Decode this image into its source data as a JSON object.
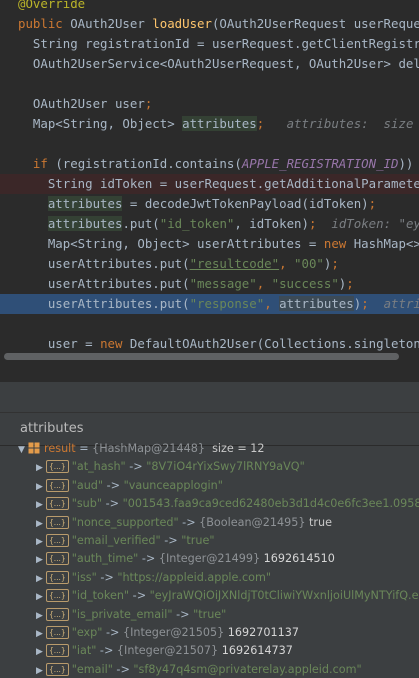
{
  "editor": {
    "lines": [
      [
        {
          "t": "@Override",
          "c": "a"
        }
      ],
      [
        {
          "t": "public ",
          "c": "k"
        },
        {
          "t": "OAuth2User ",
          "c": "p"
        },
        {
          "t": "loadUser",
          "c": "f"
        },
        {
          "t": "(OAuth2UserRequest userRequest",
          "c": "p"
        }
      ],
      [
        {
          "t": "  String registrationId = userRequest.getClientRegistrat",
          "c": "p"
        }
      ],
      [
        {
          "t": "  OAuth2UserService<OAuth2UserRequest, OAuth2User> deleg",
          "c": "p"
        }
      ],
      [],
      [
        {
          "t": "  OAuth2User user",
          "c": "p"
        },
        {
          "t": ";",
          "c": "k"
        }
      ],
      [
        {
          "t": "  Map<String, Object> ",
          "c": "p"
        },
        {
          "t": "attributes",
          "c": "p ac"
        },
        {
          "t": ";",
          "c": "k"
        },
        {
          "t": "   attributes:  size = ",
          "c": "h"
        }
      ],
      [],
      [
        {
          "t": "  ",
          "c": "p"
        },
        {
          "t": "if ",
          "c": "k"
        },
        {
          "t": "(registrationId.contains(",
          "c": "p"
        },
        {
          "t": "APPLE_REGISTRATION_ID",
          "c": "c"
        },
        {
          "t": ")) {",
          "c": "p"
        }
      ],
      [
        {
          "t": "    String idToken = userRequest.getAdditionalParameters",
          "c": "p"
        }
      ],
      [
        {
          "t": "    ",
          "c": "p"
        },
        {
          "t": "attributes",
          "c": "p ac"
        },
        {
          "t": " = decodeJwtTokenPayload(idToken)",
          "c": "p"
        },
        {
          "t": ";",
          "c": "k"
        }
      ],
      [
        {
          "t": "    ",
          "c": "p"
        },
        {
          "t": "attributes",
          "c": "p ac"
        },
        {
          "t": ".put(",
          "c": "p"
        },
        {
          "t": "\"id_token\"",
          "c": "s"
        },
        {
          "t": ", idToken)",
          "c": "p"
        },
        {
          "t": ";",
          "c": "k"
        },
        {
          "t": "  idToken: \"eyJ",
          "c": "h"
        }
      ],
      [
        {
          "t": "    Map<String, Object> userAttributes = ",
          "c": "p"
        },
        {
          "t": "new ",
          "c": "k"
        },
        {
          "t": "HashMap<>()",
          "c": "p"
        }
      ],
      [
        {
          "t": "    userAttributes.put(",
          "c": "p"
        },
        {
          "t": "\"resultcode\"",
          "c": "s su"
        },
        {
          "t": ", ",
          "c": "k"
        },
        {
          "t": "\"00\"",
          "c": "s"
        },
        {
          "t": ")",
          "c": "p"
        },
        {
          "t": ";",
          "c": "k"
        }
      ],
      [
        {
          "t": "    userAttributes.put(",
          "c": "p"
        },
        {
          "t": "\"message\"",
          "c": "s"
        },
        {
          "t": ", ",
          "c": "k"
        },
        {
          "t": "\"success\"",
          "c": "s"
        },
        {
          "t": ")",
          "c": "p"
        },
        {
          "t": ";",
          "c": "k"
        }
      ],
      [
        {
          "t": "    userAttributes.put(",
          "c": "p"
        },
        {
          "t": "\"response\"",
          "c": "s"
        },
        {
          "t": ", ",
          "c": "k"
        },
        {
          "t": "attributes",
          "c": "p ho"
        },
        {
          "t": ")",
          "c": "p"
        },
        {
          "t": ";",
          "c": "k"
        },
        {
          "t": "  attribu",
          "c": "h"
        }
      ],
      [],
      [
        {
          "t": "    user = ",
          "c": "p"
        },
        {
          "t": "new ",
          "c": "k"
        },
        {
          "t": "DefaultOAuth2User(Collections.",
          "c": "p"
        },
        {
          "t": "singleton",
          "c": "p"
        },
        {
          "t": "(n",
          "c": "p"
        }
      ]
    ]
  },
  "debugger": {
    "header_title": "attributes",
    "root": {
      "name": "result",
      "type": "{HashMap@21448}",
      "size_text": "size = 12"
    },
    "entries": [
      {
        "key": "\"at_hash\"",
        "value": "\"8V7iO4rYixSwy7lRNY9aVQ\"",
        "vclass": "v-str"
      },
      {
        "key": "\"aud\"",
        "value": "\"vaunceapplogin\"",
        "vclass": "v-str"
      },
      {
        "key": "\"sub\"",
        "value": "\"001543.faa9ca9ced62480eb3d1d4c0e6fc3ee1.0958\"",
        "vclass": "v-str"
      },
      {
        "key": "\"nonce_supported\"",
        "type": "{Boolean@21495}",
        "value": "true",
        "vclass": "v-plain"
      },
      {
        "key": "\"email_verified\"",
        "value": "\"true\"",
        "vclass": "v-str"
      },
      {
        "key": "\"auth_time\"",
        "type": "{Integer@21499}",
        "value": "1692614510",
        "vclass": "v-num"
      },
      {
        "key": "\"iss\"",
        "value": "\"https://appleid.apple.com\"",
        "vclass": "v-str"
      },
      {
        "key": "\"id_token\"",
        "value": "\"eyJraWQiOiJXNldjT0tCliwiYWxnljoiUlMyNTYifQ.e",
        "vclass": "v-str"
      },
      {
        "key": "\"is_private_email\"",
        "value": "\"true\"",
        "vclass": "v-str"
      },
      {
        "key": "\"exp\"",
        "type": "{Integer@21505}",
        "value": "1692701137",
        "vclass": "v-num"
      },
      {
        "key": "\"iat\"",
        "type": "{Integer@21507}",
        "value": "1692614737",
        "vclass": "v-num"
      },
      {
        "key": "\"email\"",
        "value": "\"sf8y47q4sm@privaterelay.appleid.com\"",
        "vclass": "v-str"
      }
    ],
    "entry_tag": "{...}",
    "arrow": "->"
  }
}
